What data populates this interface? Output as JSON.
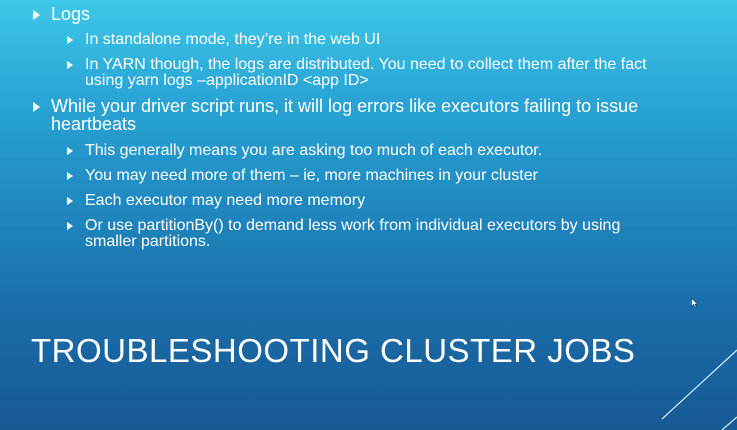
{
  "slide": {
    "title": "TROUBLESHOOTING CLUSTER JOBS",
    "bullets": {
      "logs": "Logs",
      "standalone": "In standalone mode, they’re in the web UI",
      "yarn": "In YARN though, the logs are distributed. You need to collect them after the fact using yarn logs –applicationID <app ID>",
      "driver": "While your driver script runs, it will log errors like executors failing to issue heartbeats",
      "generally": "This generally means you are asking too much of each executor.",
      "more": "You may need more of them – ie, more machines in your cluster",
      "memory": "Each executor may need more memory",
      "partition": "Or use partitionBy() to demand less work from individual executors by using smaller partitions."
    }
  },
  "colors": {
    "background_top": "#3fc8e8",
    "background_bottom": "#175a94",
    "text": "#ffffff"
  },
  "icons": {
    "bullet": "triangle-bullet-icon",
    "pointer": "mouse-pointer-icon"
  }
}
